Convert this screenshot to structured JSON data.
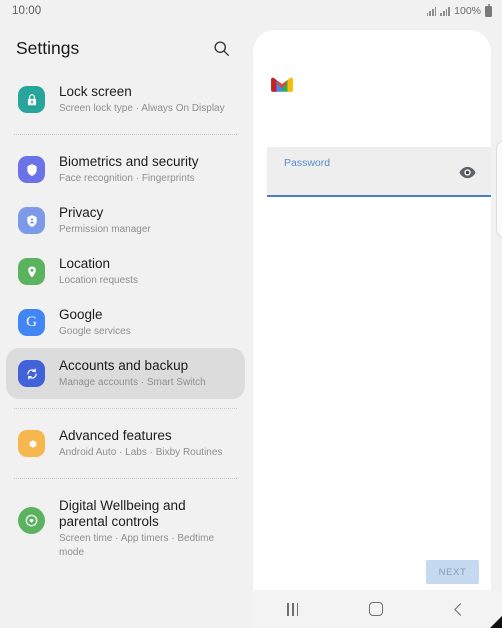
{
  "status_bar": {
    "clock": "10:00",
    "battery_percent": "100%",
    "signal_icon": "signal-bars-icon",
    "battery_icon": "battery-full-icon",
    "camera_icon": "front-camera-punch-hole"
  },
  "settings": {
    "title": "Settings",
    "search_icon": "search-icon",
    "groups": [
      {
        "items": [
          {
            "title": "Lock screen",
            "subtitle": "Screen lock type  ·  Always On Display",
            "icon": "lock-icon",
            "icon_color": "#27a59a",
            "selected": false
          }
        ]
      },
      {
        "items": [
          {
            "title": "Biometrics and security",
            "subtitle": "Face recognition  ·  Fingerprints",
            "icon": "shield-icon",
            "icon_color": "#6b72e8",
            "selected": false
          },
          {
            "title": "Privacy",
            "subtitle": "Permission manager",
            "icon": "privacy-shield-person-icon",
            "icon_color": "#7d9ae8",
            "selected": false
          },
          {
            "title": "Location",
            "subtitle": "Location requests",
            "icon": "location-pin-icon",
            "icon_color": "#5cb35f",
            "selected": false
          },
          {
            "title": "Google",
            "subtitle": "Google services",
            "icon": "google-g-icon",
            "icon_color": "#4285f4",
            "selected": false
          },
          {
            "title": "Accounts and backup",
            "subtitle": "Manage accounts  ·  Smart Switch",
            "icon": "sync-icon",
            "icon_color": "#4262d8",
            "selected": true
          }
        ]
      },
      {
        "items": [
          {
            "title": "Advanced features",
            "subtitle": "Android Auto  ·  Labs  ·  Bixby Routines",
            "icon": "gear-icon",
            "icon_color": "#f5b74e",
            "selected": false
          }
        ]
      },
      {
        "items": [
          {
            "title": "Digital Wellbeing and parental controls",
            "subtitle": "Screen time  ·  App timers  ·  Bedtime mode",
            "icon": "wellbeing-heart-icon",
            "icon_color": "#5cb35f",
            "selected": false
          }
        ]
      }
    ]
  },
  "gmail_panel": {
    "logo_icon": "gmail-logo-icon",
    "password_label": "Password",
    "password_value": "",
    "password_placeholder": "Password",
    "show_password_icon": "eye-icon",
    "next_label": "NEXT",
    "accent_color": "#4b7fc4",
    "next_button_color": "#c5d9f1"
  },
  "nav_bar": {
    "recents_icon": "recents-icon",
    "home_icon": "home-icon",
    "back_icon": "back-icon"
  }
}
